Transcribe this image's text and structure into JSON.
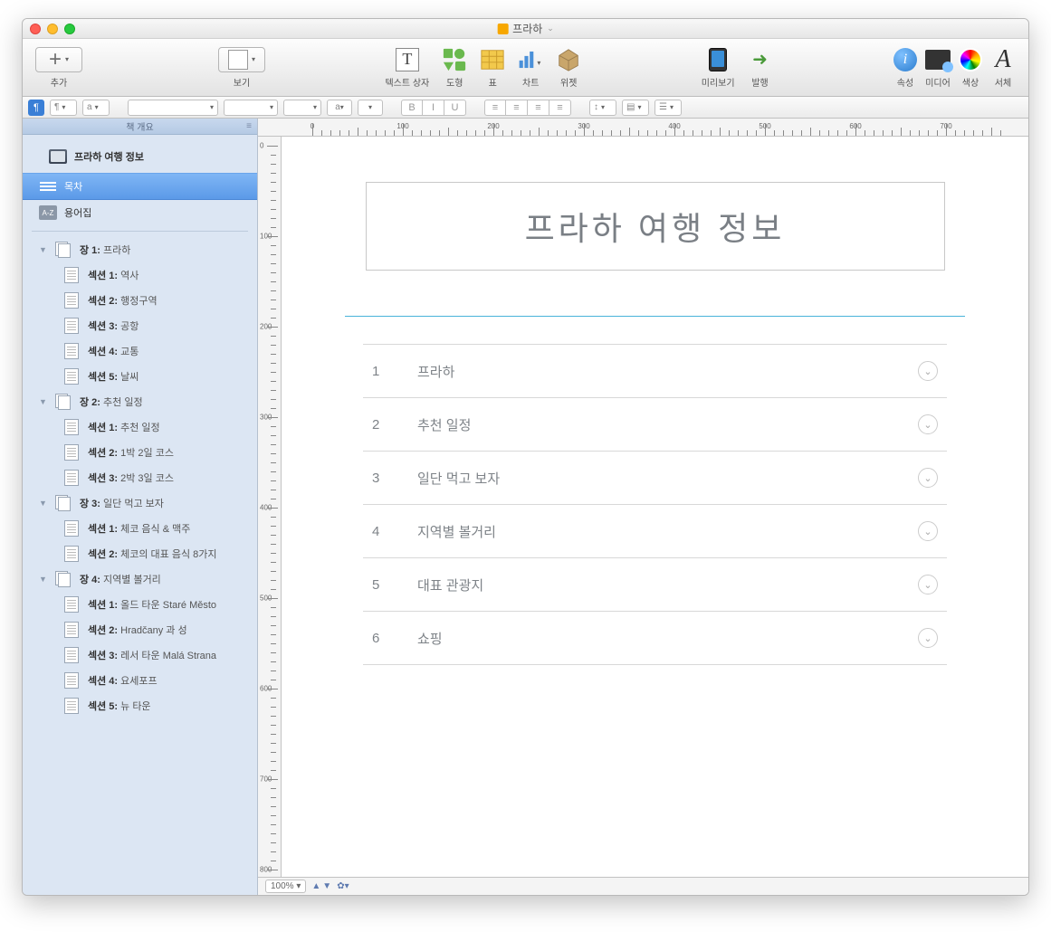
{
  "titlebar": {
    "title": "프라하"
  },
  "toolbar": {
    "add": "추가",
    "view": "보기",
    "textbox": "텍스트 상자",
    "shapes": "도형",
    "table": "표",
    "chart": "차트",
    "widget": "위젯",
    "preview": "미리보기",
    "publish": "발행",
    "inspector": "속성",
    "media": "미디어",
    "colors": "색상",
    "fonts": "서체"
  },
  "formatbar": {
    "pilcrow": "¶",
    "a_label": "a",
    "bold": "B",
    "italic": "I",
    "underline": "U"
  },
  "sidebar": {
    "header": "책 개요",
    "book_title": "프라하 여행 정보",
    "toc": "목차",
    "glossary": "용어집",
    "az": "A-Z",
    "chapters": [
      {
        "label_prefix": "장 1:",
        "label": "프라하",
        "sections": [
          {
            "prefix": "섹션 1:",
            "label": "역사"
          },
          {
            "prefix": "섹션 2:",
            "label": "행정구역"
          },
          {
            "prefix": "섹션 3:",
            "label": "공항"
          },
          {
            "prefix": "섹션 4:",
            "label": "교통"
          },
          {
            "prefix": "섹션 5:",
            "label": "날씨"
          }
        ]
      },
      {
        "label_prefix": "장 2:",
        "label": "추천 일정",
        "sections": [
          {
            "prefix": "섹션 1:",
            "label": "추천 일정"
          },
          {
            "prefix": "섹션 2:",
            "label": "1박 2일 코스"
          },
          {
            "prefix": "섹션 3:",
            "label": "2박 3일 코스"
          }
        ]
      },
      {
        "label_prefix": "장 3:",
        "label": "일단 먹고 보자",
        "sections": [
          {
            "prefix": "섹션 1:",
            "label": "체코 음식 & 맥주"
          },
          {
            "prefix": "섹션 2:",
            "label": "체코의 대표 음식 8가지"
          }
        ]
      },
      {
        "label_prefix": "장 4:",
        "label": "지역별 볼거리",
        "sections": [
          {
            "prefix": "섹션 1:",
            "label": "올드 타운 Staré Město"
          },
          {
            "prefix": "섹션 2:",
            "label": "Hradčany 과 성"
          },
          {
            "prefix": "섹션 3:",
            "label": "레서 타운 Malá Strana"
          },
          {
            "prefix": "섹션 4:",
            "label": "요세포프"
          },
          {
            "prefix": "섹션 5:",
            "label": "뉴 타운"
          }
        ]
      }
    ]
  },
  "page": {
    "title": "프라하 여행 정보",
    "toc": [
      {
        "num": "1",
        "title": "프라하"
      },
      {
        "num": "2",
        "title": "추천 일정"
      },
      {
        "num": "3",
        "title": "일단 먹고 보자"
      },
      {
        "num": "4",
        "title": "지역별 볼거리"
      },
      {
        "num": "5",
        "title": "대표 관광지"
      },
      {
        "num": "6",
        "title": "쇼핑"
      }
    ]
  },
  "ruler": {
    "marks": [
      0,
      100,
      200,
      300,
      400,
      500,
      600,
      700
    ],
    "vmarks": [
      0,
      100,
      200,
      300,
      400,
      500,
      600,
      700,
      800
    ]
  },
  "status": {
    "zoom": "100%"
  }
}
